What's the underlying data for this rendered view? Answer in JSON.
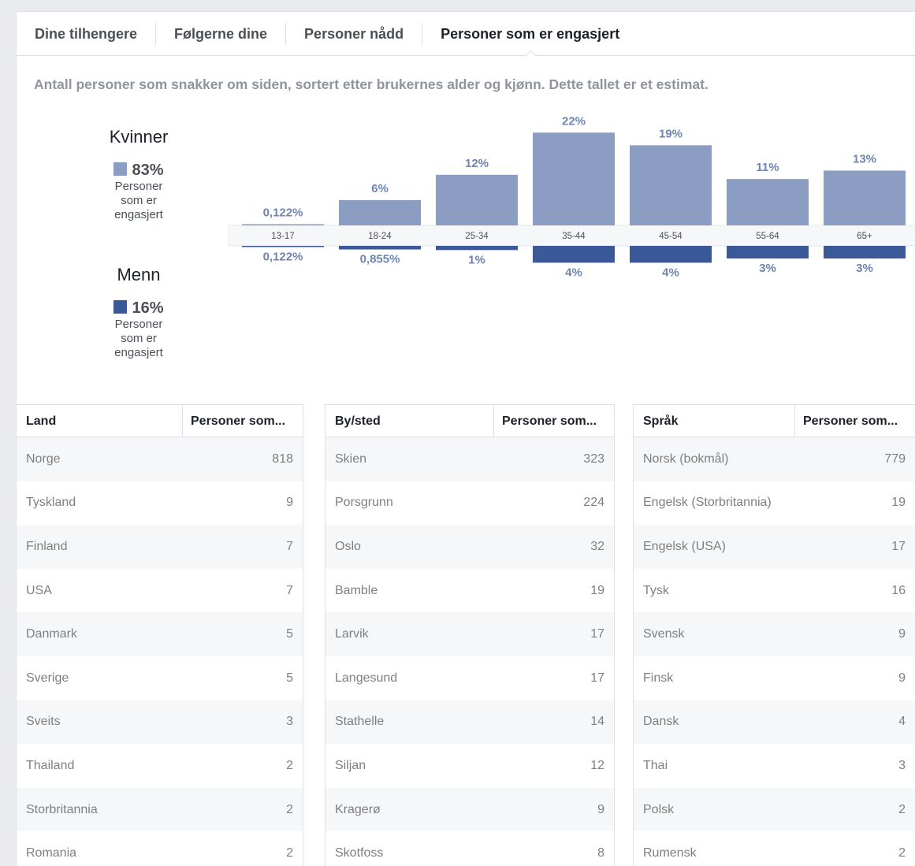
{
  "tabs": [
    {
      "label": "Dine tilhengere",
      "active": false
    },
    {
      "label": "Følgerne dine",
      "active": false
    },
    {
      "label": "Personer nådd",
      "active": false
    },
    {
      "label": "Personer som er engasjert",
      "active": true
    }
  ],
  "description": "Antall personer som snakker om siden, sortert etter brukernes alder og kjønn. Dette tallet er et estimat.",
  "legend": {
    "women": {
      "title": "Kvinner",
      "percent": "83%",
      "sub": "Personer som er engasjert",
      "color": "#8b9dc3"
    },
    "men": {
      "title": "Menn",
      "percent": "16%",
      "sub": "Personer som er engasjert",
      "color": "#3b5998"
    }
  },
  "chart_data": {
    "type": "bar",
    "categories": [
      "13-17",
      "18-24",
      "25-34",
      "35-44",
      "45-54",
      "55-64",
      "65+"
    ],
    "series": [
      {
        "name": "Kvinner",
        "values": [
          0.122,
          6,
          12,
          22,
          19,
          11,
          13
        ],
        "labels": [
          "0,122%",
          "6%",
          "12%",
          "22%",
          "19%",
          "11%",
          "13%"
        ],
        "color": "#8b9dc3"
      },
      {
        "name": "Menn",
        "values": [
          0.122,
          0.855,
          1,
          4,
          4,
          3,
          3
        ],
        "labels": [
          "0,122%",
          "0,855%",
          "1%",
          "4%",
          "4%",
          "3%",
          "3%"
        ],
        "color": "#3b5998"
      }
    ]
  },
  "tables": [
    {
      "header_name": "Land",
      "header_value": "Personer som...",
      "rows": [
        {
          "name": "Norge",
          "value": "818"
        },
        {
          "name": "Tyskland",
          "value": "9"
        },
        {
          "name": "Finland",
          "value": "7"
        },
        {
          "name": "USA",
          "value": "7"
        },
        {
          "name": "Danmark",
          "value": "5"
        },
        {
          "name": "Sverige",
          "value": "5"
        },
        {
          "name": "Sveits",
          "value": "3"
        },
        {
          "name": "Thailand",
          "value": "2"
        },
        {
          "name": "Storbritannia",
          "value": "2"
        },
        {
          "name": "Romania",
          "value": "2"
        }
      ]
    },
    {
      "header_name": "By/sted",
      "header_value": "Personer som...",
      "rows": [
        {
          "name": "Skien",
          "value": "323"
        },
        {
          "name": "Porsgrunn",
          "value": "224"
        },
        {
          "name": "Oslo",
          "value": "32"
        },
        {
          "name": "Bamble",
          "value": "19"
        },
        {
          "name": "Larvik",
          "value": "17"
        },
        {
          "name": "Langesund",
          "value": "17"
        },
        {
          "name": "Stathelle",
          "value": "14"
        },
        {
          "name": "Siljan",
          "value": "12"
        },
        {
          "name": "Kragerø",
          "value": "9"
        },
        {
          "name": "Skotfoss",
          "value": "8"
        }
      ]
    },
    {
      "header_name": "Språk",
      "header_value": "Personer som...",
      "rows": [
        {
          "name": "Norsk (bokmål)",
          "value": "779"
        },
        {
          "name": "Engelsk (Storbritannia)",
          "value": "19"
        },
        {
          "name": "Engelsk (USA)",
          "value": "17"
        },
        {
          "name": "Tysk",
          "value": "16"
        },
        {
          "name": "Svensk",
          "value": "9"
        },
        {
          "name": "Finsk",
          "value": "9"
        },
        {
          "name": "Dansk",
          "value": "4"
        },
        {
          "name": "Thai",
          "value": "3"
        },
        {
          "name": "Polsk",
          "value": "2"
        },
        {
          "name": "Rumensk",
          "value": "2"
        }
      ]
    }
  ]
}
